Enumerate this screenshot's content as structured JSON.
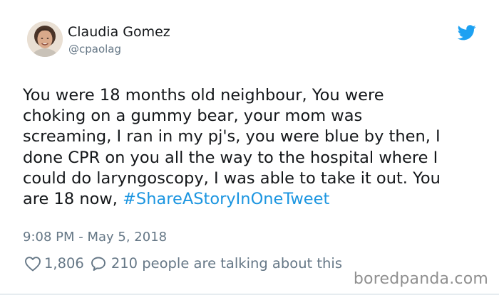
{
  "user": {
    "display_name": "Claudia Gomez",
    "handle": "@cpaolag",
    "avatar_icon": "profile-photo"
  },
  "brand": {
    "logo_icon": "twitter-bird-icon",
    "accent_color": "#1da1f2"
  },
  "tweet": {
    "lines": [
      "You were 18 months old neighbour, You were",
      "choking on a gummy bear, your mom was",
      "screaming, I ran in my pj's, you were blue by then, I",
      "done CPR on you all the way to the hospital where I",
      "could do laryngoscopy, I was able to take it out. You"
    ],
    "last_line_prefix": "are 18 now, ",
    "hashtag": "#ShareAStoryInOneTweet",
    "hashtag_color": "#1b95e0",
    "timestamp": "9:08 PM - May 5, 2018"
  },
  "engagement": {
    "like_icon": "heart-icon",
    "likes": "1,806",
    "reply_icon": "speech-bubble-icon",
    "talking": "210 people are talking about this"
  },
  "watermark": {
    "text": "boredpanda.com"
  }
}
